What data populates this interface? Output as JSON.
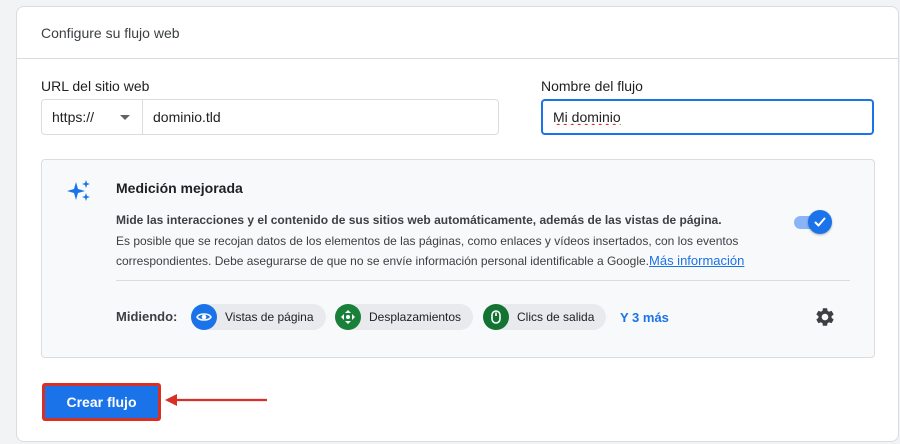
{
  "card": {
    "title": "Configure su flujo web"
  },
  "url_field": {
    "label": "URL del sitio web",
    "protocol": "https://",
    "domain_value": "dominio.tld"
  },
  "stream_name": {
    "label": "Nombre del flujo",
    "value": "Mi dominio"
  },
  "enhanced_measurement": {
    "title": "Medición mejorada",
    "description_strong": "Mide las interacciones y el contenido de sus sitios web automáticamente, además de las vistas de página.",
    "description": "Es posible que se recojan datos de los elementos de las páginas, como enlaces y vídeos insertados, con los eventos correspondientes. Debe asegurarse de que no se envíe información personal identificable a Google.",
    "learn_more": "Más información",
    "toggle_on": true,
    "measuring_label": "Midiendo:",
    "chips": [
      {
        "label": "Vistas de página",
        "icon": "eye-icon"
      },
      {
        "label": "Desplazamientos",
        "icon": "scroll-icon"
      },
      {
        "label": "Clics de salida",
        "icon": "mouse-icon"
      }
    ],
    "more": "Y 3 más"
  },
  "create_button": {
    "label": "Crear flujo"
  },
  "colors": {
    "accent": "#1a73e8",
    "annotation": "#d93025",
    "chip_green": "#188038"
  }
}
